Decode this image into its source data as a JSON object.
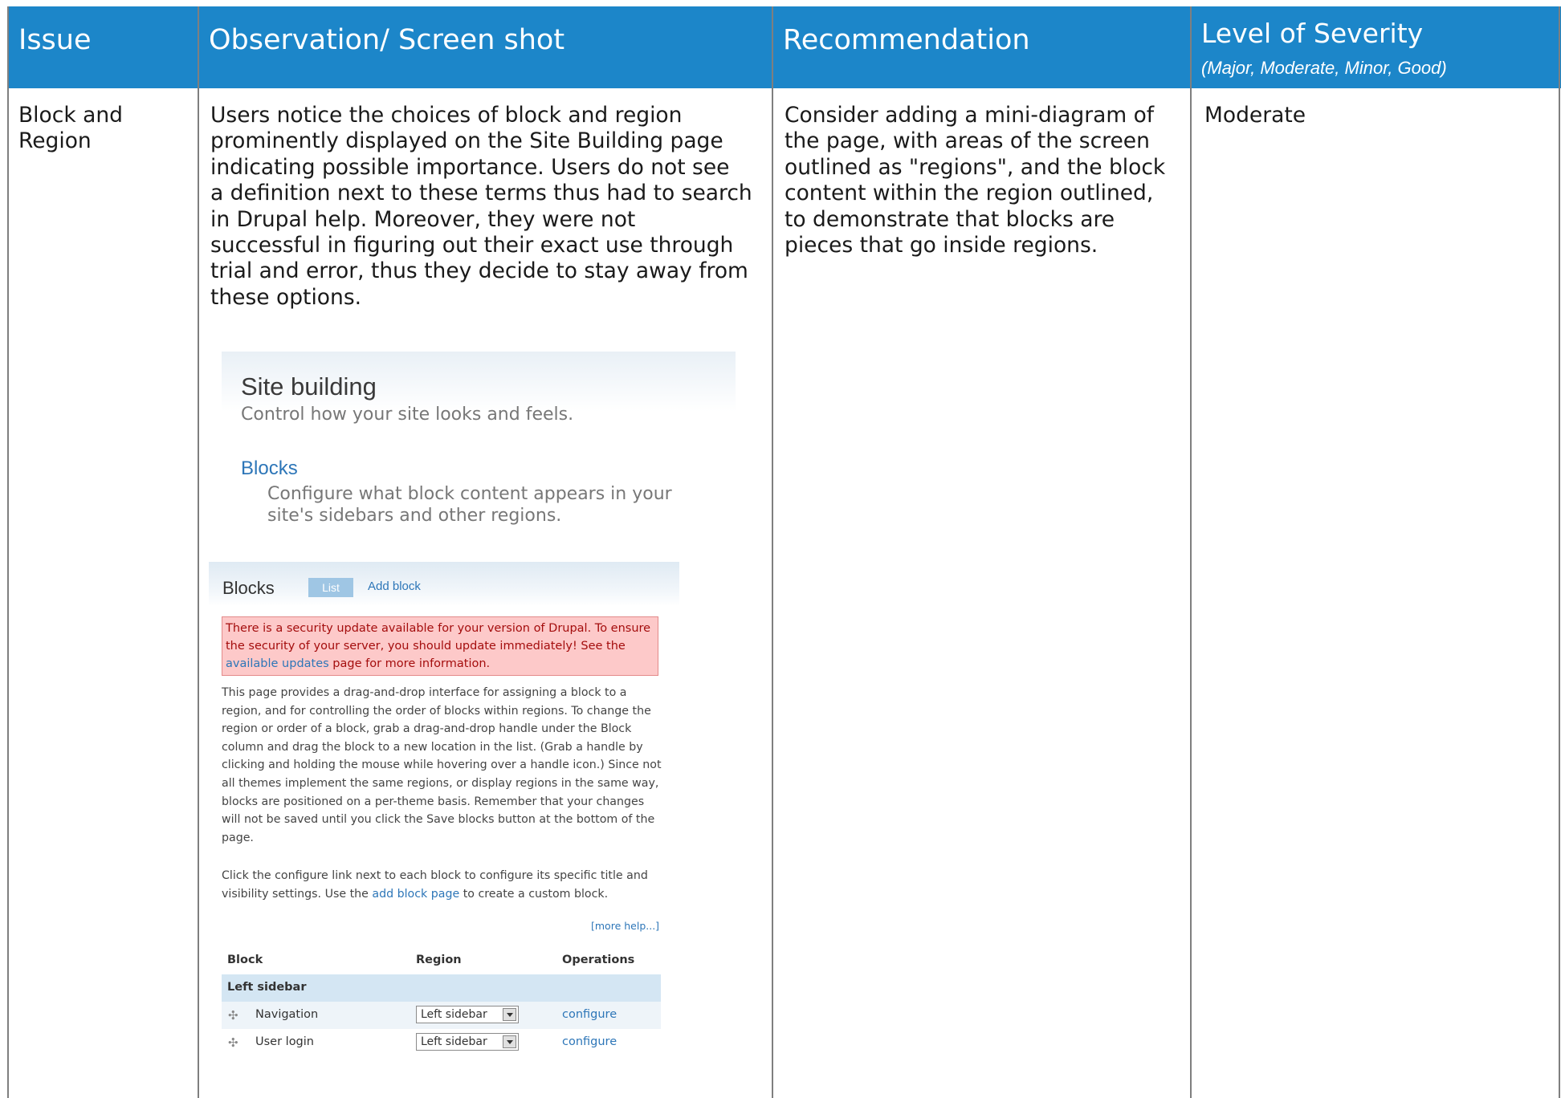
{
  "header": {
    "issue": "Issue",
    "observation": "Observation/ Screen shot",
    "recommendation": "Recommendation",
    "severity": "Level of Severity",
    "severity_scale": "(Major, Moderate, Minor, Good)"
  },
  "row": {
    "issue_lines": [
      "Block and",
      "Region"
    ],
    "observation_lines": [
      "Users notice the choices of block and region",
      "prominently displayed on the Site Building page",
      "indicating possible importance.  Users do not see",
      "a definition next to these terms thus had to search",
      "in Drupal help.  Moreover, they were not",
      "successful in figuring out their exact use through",
      "trial and error, thus they decide to stay away from",
      "these options."
    ],
    "recommendation_lines": [
      "Consider adding a mini-diagram of",
      "the page, with areas of the screen",
      "outlined as \"regions\", and the block",
      "content within the region outlined,",
      "to demonstrate that blocks are",
      "pieces that go inside regions."
    ],
    "severity": "Moderate"
  },
  "screenshot": {
    "site_building": {
      "title": "Site building",
      "subtitle": "Control how your site looks and feels.",
      "blocks_link": "Blocks",
      "blocks_desc": [
        "Configure what block content appears in your",
        "site's sidebars and other regions."
      ]
    },
    "blocks_page": {
      "title": "Blocks",
      "tab_list": "List",
      "tab_add": "Add block",
      "alert": {
        "line1": "There is a security update available for your version of Drupal. To ensure",
        "line2": "the security of your server, you should update immediately! See the",
        "link": "available updates",
        "rest": " page for more information."
      },
      "help": [
        "This page provides a drag-and-drop interface for assigning a block to a",
        "region, and for controlling the order of blocks within regions. To change the",
        "region or order of a block, grab a drag-and-drop handle under the Block",
        "column and drag the block to a new location in the list. (Grab a handle by",
        "clicking and holding the mouse while hovering over a handle icon.) Since not",
        "all themes implement the same regions, or display regions in the same way,",
        "blocks are positioned on a per-theme basis. Remember that your changes",
        "will not be saved until you click the Save blocks button at the bottom of the",
        "page."
      ],
      "configure_help": {
        "line1": "Click the configure link next to each block to configure its specific title and",
        "line2_pre": "visibility settings. Use the ",
        "line2_link": "add block page",
        "line2_post": " to create a custom block."
      },
      "more_help": "[more help...]",
      "table": {
        "headers": [
          "Block",
          "Region",
          "Operations"
        ],
        "group": "Left sidebar",
        "rows": [
          {
            "block": "Navigation",
            "region": "Left sidebar",
            "op": "configure"
          },
          {
            "block": "User login",
            "region": "Left sidebar",
            "op": "configure"
          }
        ]
      }
    }
  }
}
